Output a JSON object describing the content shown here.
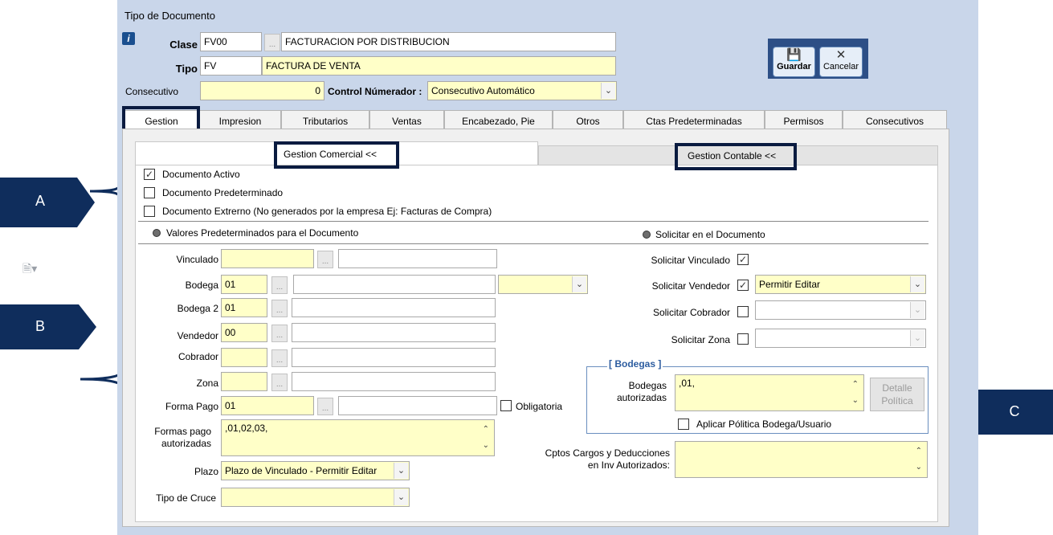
{
  "window": {
    "title": "Tipo de Documento"
  },
  "header": {
    "clase_label": "Clase",
    "clase_code": "FV00",
    "clase_desc": "FACTURACION POR DISTRIBUCION",
    "tipo_label": "Tipo",
    "tipo_code": "FV",
    "tipo_desc": "FACTURA DE VENTA",
    "consecutivo_label": "Consecutivo",
    "consecutivo_value": "0",
    "control_label": "Control Númerador :",
    "control_value": "Consecutivo Automático",
    "dots": "..."
  },
  "toolbar": {
    "save_label": "Guardar",
    "cancel_label": "Cancelar"
  },
  "tabs": [
    {
      "label": "Gestion"
    },
    {
      "label": "Impresion"
    },
    {
      "label": "Tributarios"
    },
    {
      "label": "Ventas"
    },
    {
      "label": "Encabezado, Pie"
    },
    {
      "label": "Otros"
    },
    {
      "label": "Ctas Predeterminadas"
    },
    {
      "label": "Permisos"
    },
    {
      "label": "Consecutivos"
    }
  ],
  "subtabs": {
    "comercial": "Gestion Comercial <<",
    "contable": "Gestion Contable <<"
  },
  "checks": {
    "activo": "Documento Activo",
    "predeterminado": "Documento Predeterminado",
    "externo": "Documento Extrerno (No generados por la empresa  Ej: Facturas de Compra)"
  },
  "sections": {
    "valores": "Valores Predeterminados para el Documento",
    "solicitar": "Solicitar en el Documento"
  },
  "left": {
    "vinculado_label": "Vinculado",
    "bodega_label": "Bodega",
    "bodega_value": "01",
    "bodega2_label": "Bodega 2",
    "bodega2_value": "01",
    "vendedor_label": "Vendedor",
    "vendedor_value": "00",
    "cobrador_label": "Cobrador",
    "zona_label": "Zona",
    "formapago_label": "Forma Pago",
    "formapago_value": "01",
    "obligatoria_label": "Obligatoria",
    "formas_label_1": "Formas pago",
    "formas_label_2": "autorizadas",
    "formas_value": ",01,02,03,",
    "plazo_label": "Plazo",
    "plazo_value": "Plazo de Vinculado - Permitir Editar",
    "cruce_label": "Tipo de Cruce"
  },
  "right": {
    "sol_vinculado": "Solicitar Vinculado",
    "sol_vendedor": "Solicitar Vendedor",
    "sol_vendedor_value": "Permitir Editar",
    "sol_cobrador": "Solicitar Cobrador",
    "sol_zona": "Solicitar Zona",
    "bodegas_title": "[ Bodegas ]",
    "bodegas_label_1": "Bodegas",
    "bodegas_label_2": "autorizadas",
    "bodegas_value": ",01,",
    "detalle_1": "Detalle",
    "detalle_2": "Política",
    "aplicar_label": "Aplicar Pólitica Bodega/Usuario",
    "cptos_label_1": "Cptos Cargos y Deducciones",
    "cptos_label_2": "en Inv Autorizados:"
  },
  "annotations": {
    "a": "A",
    "b": "B",
    "c": "C"
  }
}
